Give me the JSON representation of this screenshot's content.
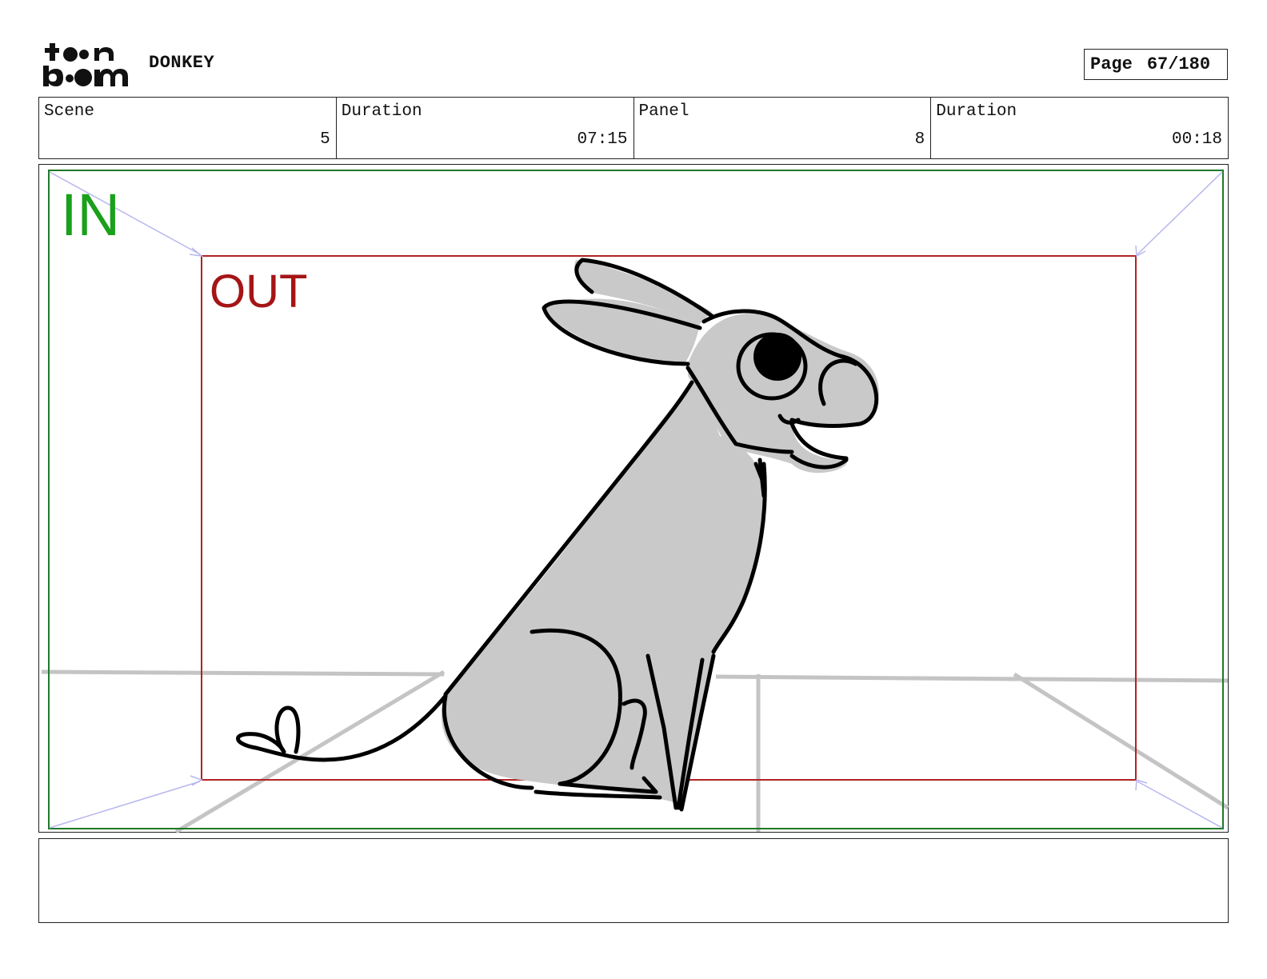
{
  "header": {
    "logo_text_top": "toon",
    "logo_text_bottom": "boom",
    "project_title": "DONKEY",
    "page_label": "Page",
    "page_value": "67/180"
  },
  "info": {
    "scene_label": "Scene",
    "scene_value": "5",
    "scene_duration_label": "Duration",
    "scene_duration_value": "07:15",
    "panel_label": "Panel",
    "panel_value": "8",
    "panel_duration_label": "Duration",
    "panel_duration_value": "00:18"
  },
  "panel": {
    "in_label": "IN",
    "out_label": "OUT",
    "in_color": "#1aa01a",
    "out_color": "#a51515",
    "subject_icon": "donkey-sketch"
  },
  "notes": {
    "text": ""
  }
}
